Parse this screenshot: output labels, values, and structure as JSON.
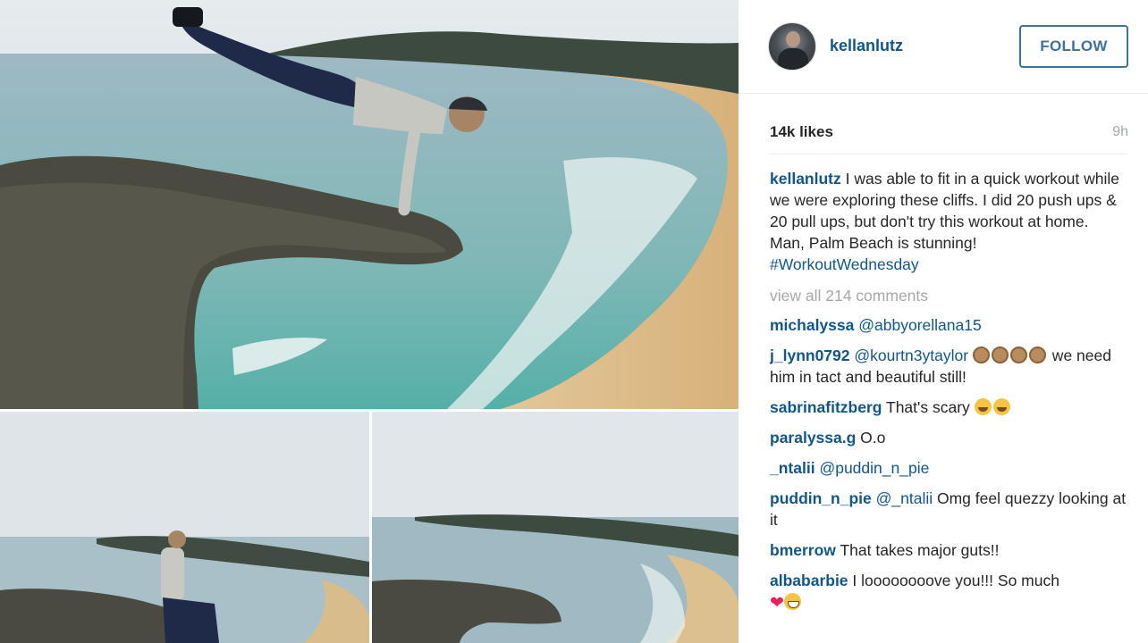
{
  "post": {
    "username": "kellanlutz",
    "follow_label": "FOLLOW",
    "likes": "14k likes",
    "time_ago": "9h"
  },
  "caption": {
    "user": "kellanlutz",
    "text": " I was able to fit in a quick workout while we were exploring these cliffs. I did 20 push ups & 20 pull ups, but don't try this workout at home. Man, Palm Beach is stunning! ",
    "hashtag": "#WorkoutWednesday"
  },
  "view_all": "view all 214 comments",
  "comments": [
    {
      "user": "michalyssa",
      "mention": "@abbyorellana15",
      "text": ""
    },
    {
      "user": "j_lynn0792",
      "mention": "@kourtn3ytaylor",
      "text": " we need him in tact and beautiful still!"
    },
    {
      "user": "sabrinafitzberg",
      "mention": "",
      "text": " That's scary "
    },
    {
      "user": "paralyssa.g",
      "mention": "",
      "text": " O.o"
    },
    {
      "user": "_ntalii",
      "mention": "@puddin_n_pie",
      "text": ""
    },
    {
      "user": "puddin_n_pie",
      "mention": "@_ntalii",
      "text": " Omg feel quezzy looking at it"
    },
    {
      "user": "bmerrow",
      "mention": "",
      "text": " That takes major guts!!"
    },
    {
      "user": "albabarbie",
      "mention": "",
      "text": " I loooooooove you!!! So much "
    }
  ],
  "icons": {
    "avatar": "profile-photo",
    "monkey": "see-no-evil-monkey-emoji",
    "laugh": "tears-of-joy-emoji",
    "heart": "red-heart-emoji",
    "grin": "grinning-emoji"
  },
  "colors": {
    "link": "#125688",
    "follow": "#3f729b",
    "muted": "#a5a7aa"
  }
}
